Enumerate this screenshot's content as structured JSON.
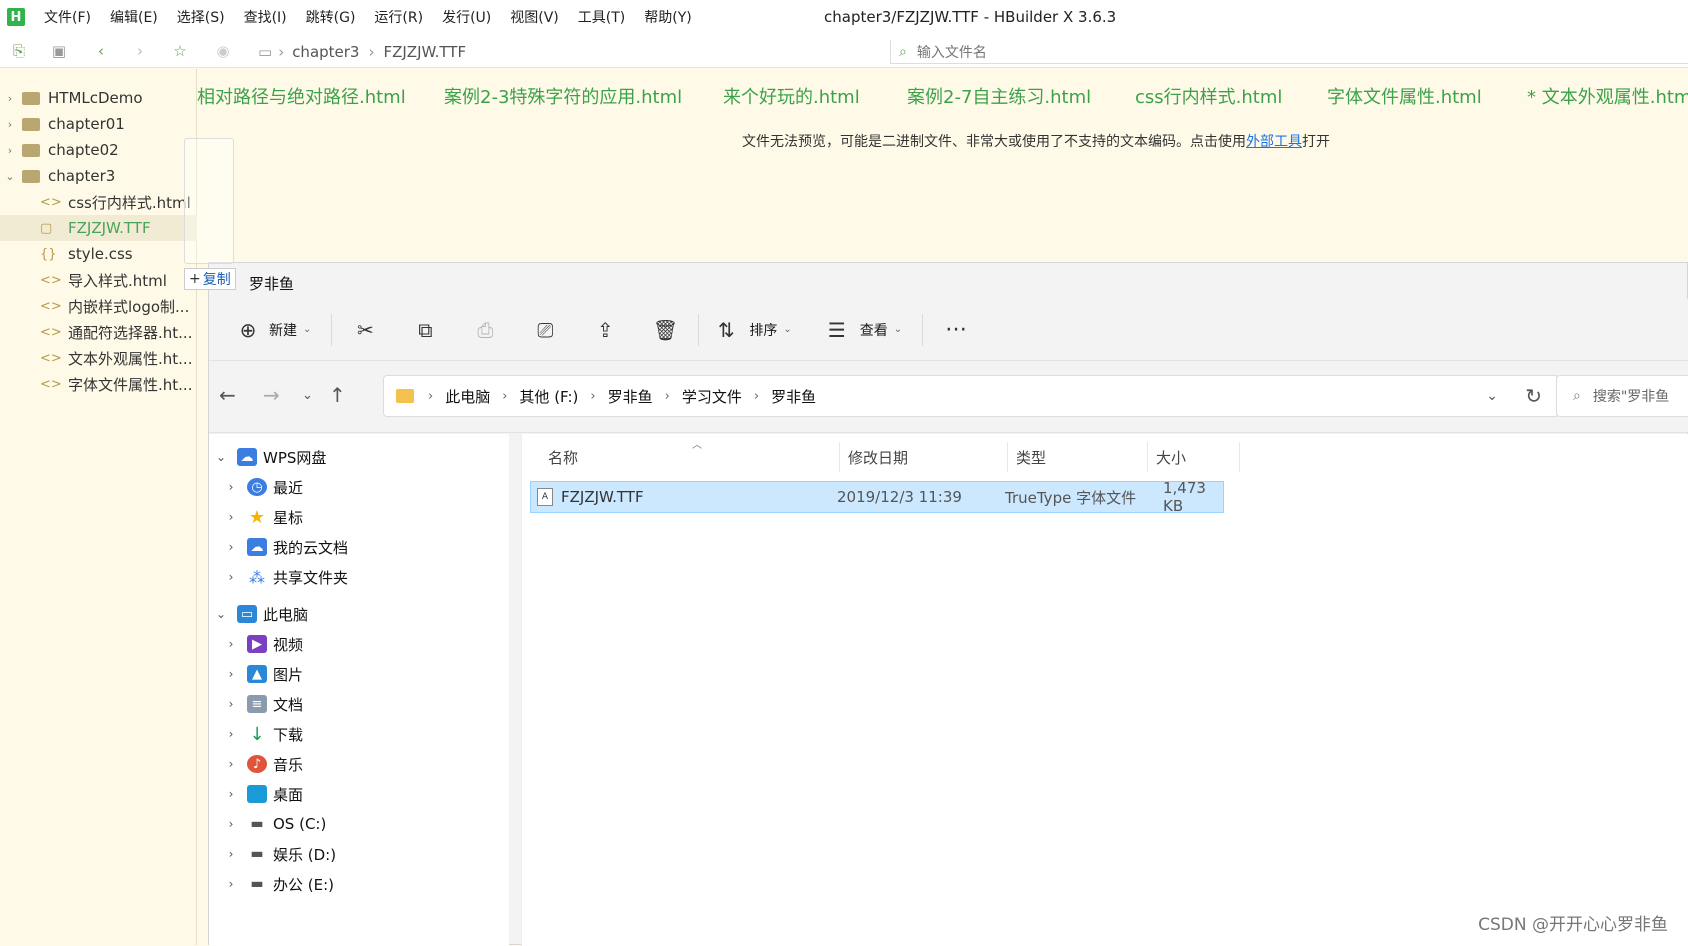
{
  "hbuilder": {
    "logo": "H",
    "menu": [
      "文件(F)",
      "编辑(E)",
      "选择(S)",
      "查找(I)",
      "跳转(G)",
      "运行(R)",
      "发行(U)",
      "视图(V)",
      "工具(T)",
      "帮助(Y)"
    ],
    "window_title": "chapter3/FZJZJW.TTF - HBuilder X 3.6.3",
    "breadcrumb": [
      "chapter3",
      "FZJZJW.TTF"
    ],
    "file_search_placeholder": "输入文件名",
    "tree": [
      {
        "label": "HTMLcDemo",
        "type": "folder",
        "expanded": false
      },
      {
        "label": "chapter01",
        "type": "folder",
        "expanded": false
      },
      {
        "label": "chapte02",
        "type": "folder",
        "expanded": false
      },
      {
        "label": "chapter3",
        "type": "folder",
        "expanded": true
      },
      {
        "label": "css行内样式.html",
        "type": "html"
      },
      {
        "label": "FZJZJW.TTF",
        "type": "file",
        "selected": true
      },
      {
        "label": "style.css",
        "type": "css"
      },
      {
        "label": "导入样式.html",
        "type": "html"
      },
      {
        "label": "内嵌样式logo制...",
        "type": "html"
      },
      {
        "label": "通配符选择器.ht...",
        "type": "html"
      },
      {
        "label": "文本外观属性.ht...",
        "type": "html"
      },
      {
        "label": "字体文件属性.ht...",
        "type": "html"
      }
    ],
    "tabs": [
      "相对路径与绝对路径.html",
      "案例2-3特殊字符的应用.html",
      "来个好玩的.html",
      "案例2-7自主练习.html",
      "css行内样式.html",
      "字体文件属性.html",
      "* 文本外观属性.html"
    ],
    "preview_message_before": "文件无法预览，可能是二进制文件、非常大或使用了不支持的文本编码。点击使用",
    "preview_message_link": "外部工具",
    "preview_message_after": "打开",
    "accent_color": "#3ba24b"
  },
  "drag": {
    "copy_label": "复制"
  },
  "explorer": {
    "title": "罗非鱼",
    "commands": {
      "new": "新建",
      "sort": "排序",
      "view": "查看"
    },
    "address": [
      "此电脑",
      "其他 (F:)",
      "罗非鱼",
      "学习文件",
      "罗非鱼"
    ],
    "search_placeholder": "搜索\"罗非鱼",
    "nav": [
      {
        "label": "WPS网盘",
        "level": 0,
        "expanded": true,
        "icon": "cloud-icon",
        "color": "#3b7de0"
      },
      {
        "label": "最近",
        "level": 1,
        "icon": "clock-icon",
        "color": "#3b7de0"
      },
      {
        "label": "星标",
        "level": 1,
        "icon": "star-icon",
        "color": "#f4b400"
      },
      {
        "label": "我的云文档",
        "level": 1,
        "icon": "cloud-icon",
        "color": "#3b7de0"
      },
      {
        "label": "共享文件夹",
        "level": 1,
        "icon": "share-icon",
        "color": "#3b7de0"
      },
      {
        "label": "此电脑",
        "level": 0,
        "expanded": true,
        "icon": "monitor-icon",
        "color": "#2b88d8"
      },
      {
        "label": "视频",
        "level": 1,
        "icon": "video-icon",
        "color": "#7b3fc4"
      },
      {
        "label": "图片",
        "level": 1,
        "icon": "picture-icon",
        "color": "#2b88d8"
      },
      {
        "label": "文档",
        "level": 1,
        "icon": "document-icon",
        "color": "#8a9bb0"
      },
      {
        "label": "下载",
        "level": 1,
        "icon": "download-icon",
        "color": "#1a9e5a"
      },
      {
        "label": "音乐",
        "level": 1,
        "icon": "music-icon",
        "color": "#e0543c"
      },
      {
        "label": "桌面",
        "level": 1,
        "icon": "desktop-icon",
        "color": "#1a9ad6"
      },
      {
        "label": "OS (C:)",
        "level": 1,
        "icon": "drive-icon",
        "color": "#555555"
      },
      {
        "label": "娱乐 (D:)",
        "level": 1,
        "icon": "drive-icon",
        "color": "#555555"
      },
      {
        "label": "办公 (E:)",
        "level": 1,
        "icon": "drive-icon",
        "color": "#555555"
      }
    ],
    "columns": [
      "名称",
      "修改日期",
      "类型",
      "大小"
    ],
    "files": [
      {
        "name": "FZJZJW.TTF",
        "modified": "2019/12/3 11:39",
        "type": "TrueType 字体文件",
        "size": "1,473 KB"
      }
    ]
  },
  "watermark": "CSDN @开开心心罗非鱼"
}
